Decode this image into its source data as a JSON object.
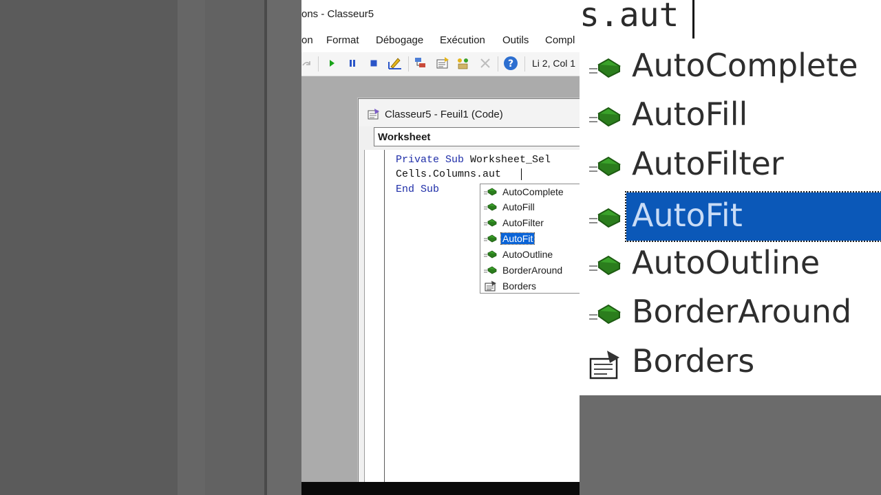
{
  "window": {
    "title": "ons - Classeur5"
  },
  "menu": [
    "on",
    "Format",
    "Débogage",
    "Exécution",
    "Outils",
    "Compl"
  ],
  "toolbar": {
    "buttons": [
      "redo-icon",
      "run-icon",
      "pause-icon",
      "stop-icon",
      "design-mode-icon",
      "project-explorer-icon",
      "properties-icon",
      "object-browser-icon",
      "toolbox-icon",
      "help-icon"
    ],
    "status": "Li 2, Col 1"
  },
  "code_window": {
    "title": "Classeur5 - Feuil1 (Code)",
    "object_combo": "Worksheet",
    "lines": [
      {
        "kw": "Private Sub",
        "rest": " Worksheet_Sel"
      },
      {
        "kw": "",
        "rest": "Cells.Columns.aut"
      },
      {
        "kw": "End Sub",
        "rest": ""
      }
    ]
  },
  "autocomplete": {
    "selected": "AutoFit",
    "items": [
      {
        "label": "AutoComplete",
        "icon": "method-icon"
      },
      {
        "label": "AutoFill",
        "icon": "method-icon"
      },
      {
        "label": "AutoFilter",
        "icon": "method-icon"
      },
      {
        "label": "AutoFit",
        "icon": "method-icon"
      },
      {
        "label": "AutoOutline",
        "icon": "method-icon"
      },
      {
        "label": "BorderAround",
        "icon": "method-icon"
      },
      {
        "label": "Borders",
        "icon": "property-icon"
      }
    ]
  },
  "zoom": {
    "code_fragment": "s.aut"
  },
  "colors": {
    "selection": "#0a64d8",
    "keyword": "#1f2ea8",
    "method_icon": "#3aa22a"
  }
}
